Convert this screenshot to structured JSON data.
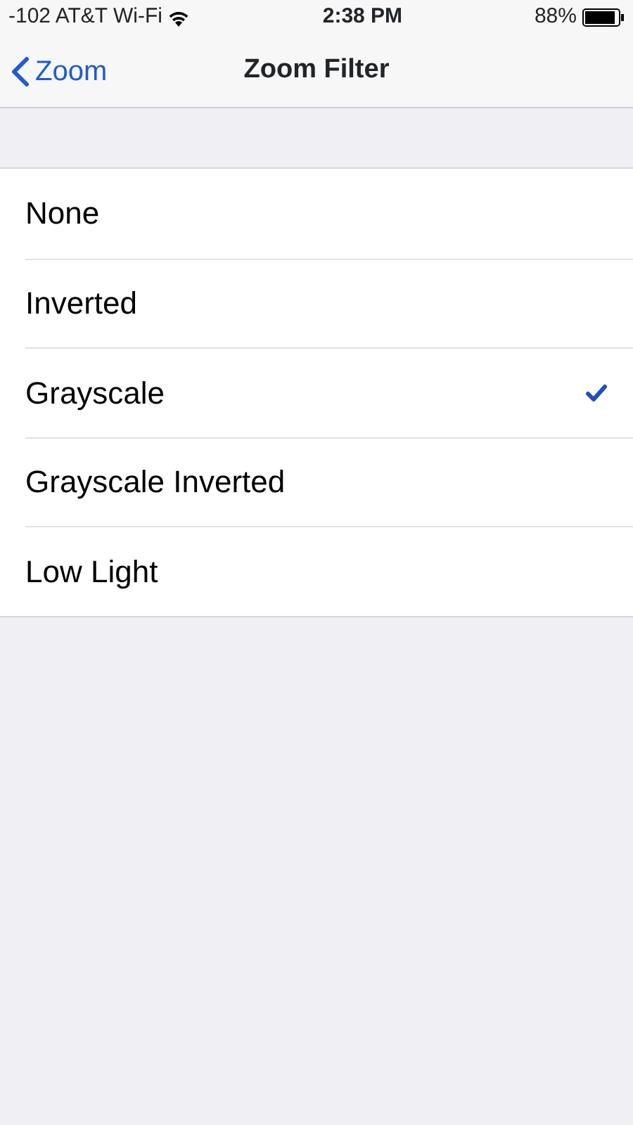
{
  "status_bar": {
    "carrier": "-102 AT&T Wi-Fi",
    "time": "2:38 PM",
    "battery": "88%"
  },
  "nav_bar": {
    "back": "Zoom",
    "title": "Zoom Filter"
  },
  "options": [
    {
      "label": "None",
      "selected": false
    },
    {
      "label": "Inverted",
      "selected": false
    },
    {
      "label": "Grayscale",
      "selected": true
    },
    {
      "label": "Grayscale Inverted",
      "selected": false
    },
    {
      "label": "Low Light",
      "selected": false
    }
  ]
}
